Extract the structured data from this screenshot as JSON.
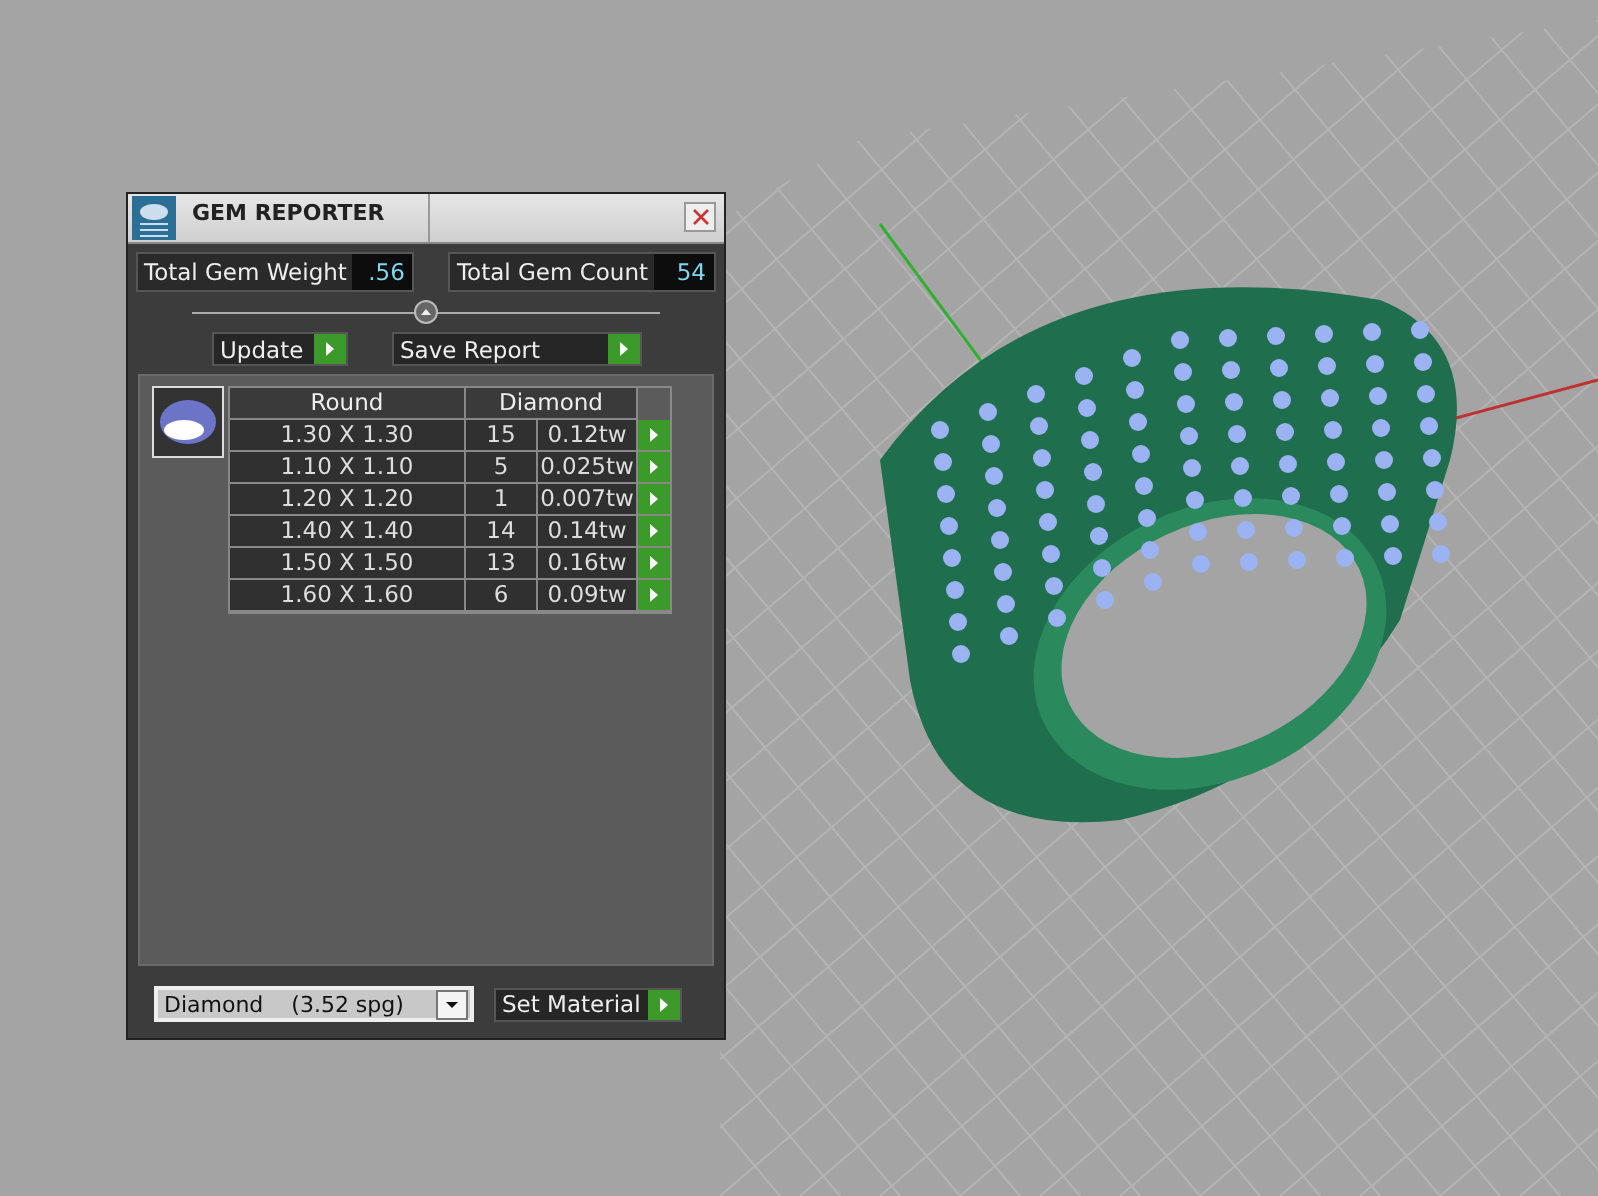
{
  "panel": {
    "title": "GEM REPORTER",
    "total_weight": {
      "label": "Total Gem Weight",
      "value": ".56"
    },
    "total_count": {
      "label": "Total Gem Count",
      "value": "54"
    },
    "buttons": [
      {
        "label": "Update"
      },
      {
        "label": "Save Report"
      }
    ],
    "table": {
      "columns": [
        "Round",
        "Diamond"
      ],
      "rows": [
        {
          "size": "1.30 X 1.30",
          "count": "15",
          "weight": "0.12tw"
        },
        {
          "size": "1.10 X 1.10",
          "count": "5",
          "weight": "0.025tw"
        },
        {
          "size": "1.20 X 1.20",
          "count": "1",
          "weight": "0.007tw"
        },
        {
          "size": "1.40 X 1.40",
          "count": "14",
          "weight": "0.14tw"
        },
        {
          "size": "1.50 X 1.50",
          "count": "13",
          "weight": "0.16tw"
        },
        {
          "size": "1.60 X 1.60",
          "count": "6",
          "weight": "0.09tw"
        }
      ]
    },
    "material": {
      "value": "Diamond    (3.52 spg)"
    },
    "set_button": {
      "label": "Set Material"
    }
  }
}
